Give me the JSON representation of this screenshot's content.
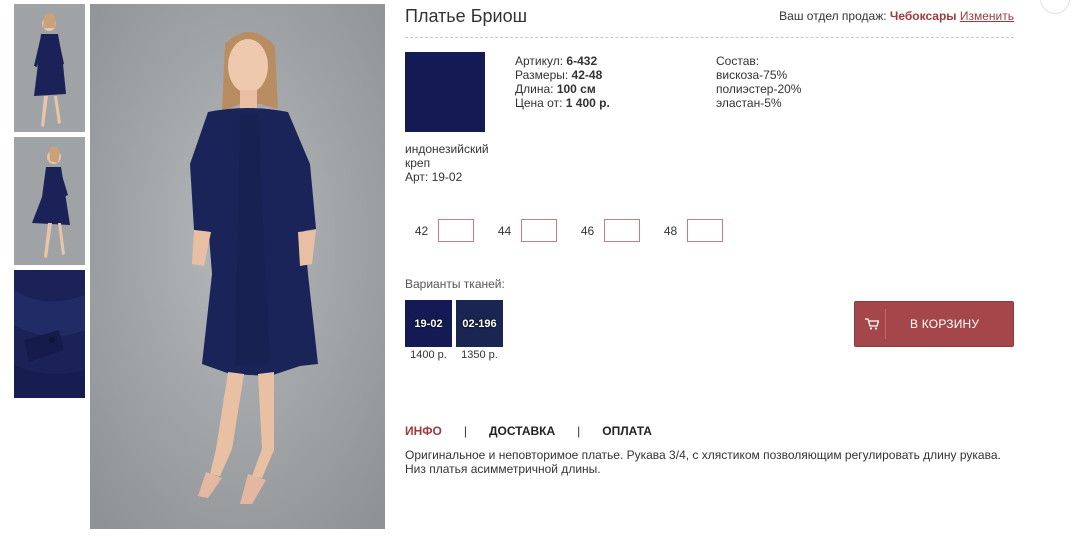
{
  "product": {
    "title": "Платье Бриош",
    "article_label": "Артикул:",
    "article": "6-432",
    "sizes_label": "Размеры:",
    "sizes": "42-48",
    "length_label": "Длина:",
    "length": "100 см",
    "price_label": "Цена от:",
    "price": "1 400 р."
  },
  "sales_dept": {
    "label": "Ваш отдел продаж:",
    "city": "Чебоксары",
    "change": "Изменить"
  },
  "fabric": {
    "name": "индонезийский креп",
    "article": "Арт: 19-02",
    "color": "#141a54"
  },
  "composition": {
    "title": "Состав:",
    "items": [
      "вискоза-75%",
      "полиэстер-20%",
      "эластан-5%"
    ]
  },
  "size_inputs": [
    {
      "size": "42",
      "value": ""
    },
    {
      "size": "44",
      "value": ""
    },
    {
      "size": "46",
      "value": ""
    },
    {
      "size": "48",
      "value": ""
    }
  ],
  "variants": {
    "title": "Варианты тканей:",
    "items": [
      {
        "code": "19-02",
        "price": "1400 р."
      },
      {
        "code": "02-196",
        "price": "1350 р."
      }
    ]
  },
  "cart": {
    "label": "В КОРЗИНУ",
    "icon": "cart-icon",
    "color": "#a5474a"
  },
  "tabs": [
    {
      "label": "ИНФО",
      "active": true
    },
    {
      "label": "ДОСТАВКА",
      "active": false
    },
    {
      "label": "ОПЛАТА",
      "active": false
    }
  ],
  "tab_separator": "|",
  "description": "Оригинальное и неповторимое платье. Рукава 3/4, с хлястиком позволяющим регулировать длину рукава. Низ платья асимметричной длины.",
  "colors": {
    "accent": "#9c3b3e",
    "dress": "#141a54"
  }
}
